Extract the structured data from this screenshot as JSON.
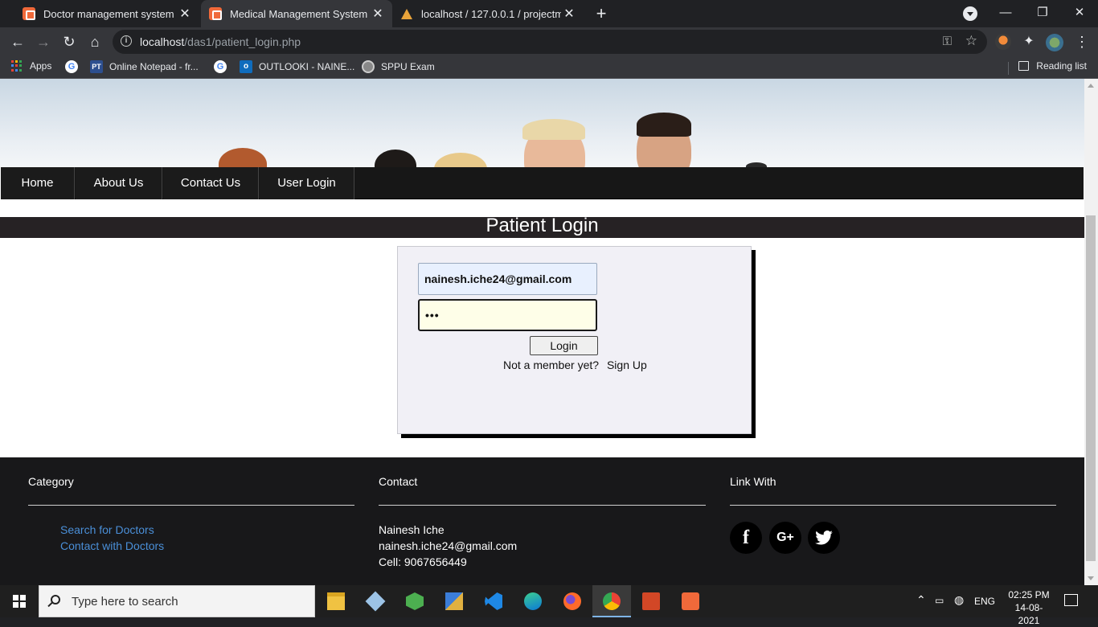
{
  "browser": {
    "tabs": [
      {
        "label": "Doctor management system",
        "active": false
      },
      {
        "label": "Medical Management System",
        "active": true
      },
      {
        "label": "localhost / 127.0.0.1 / projectmm",
        "active": false
      }
    ],
    "url_host": "localhost",
    "url_path": "/das1/patient_login.php",
    "bookmarks": [
      {
        "label": "Apps"
      },
      {
        "label": "Online Notepad - fr..."
      },
      {
        "label": "OUTLOOKI - NAINE..."
      },
      {
        "label": "SPPU Exam"
      }
    ],
    "reading_list": "Reading list"
  },
  "nav": {
    "items": [
      "Home",
      "About Us",
      "Contact Us",
      "User Login"
    ]
  },
  "login": {
    "title": "Patient Login",
    "email_value": "nainesh.iche24@gmail.com",
    "password_value": "•••",
    "login_button": "Login",
    "member_text": "Not a member yet?",
    "signup_link": "Sign Up"
  },
  "footer": {
    "category": {
      "heading": "Category",
      "links": [
        "Search for Doctors",
        "Contact with Doctors"
      ]
    },
    "contact": {
      "heading": "Contact",
      "name": "Nainesh Iche",
      "email": "nainesh.iche24@gmail.com",
      "cell": "Cell: 9067656449"
    },
    "link_with": {
      "heading": "Link With",
      "icons": [
        "facebook-icon",
        "google-plus-icon",
        "twitter-icon"
      ]
    }
  },
  "taskbar": {
    "search_placeholder": "Type here to search",
    "language": "ENG",
    "time": "02:25 PM",
    "date": "14-08-2021"
  },
  "colors": {
    "nav_bg": "#171717",
    "footer_bg": "#18181a",
    "link_blue": "#4a8fd8",
    "login_box_bg": "#f1f0f6"
  }
}
